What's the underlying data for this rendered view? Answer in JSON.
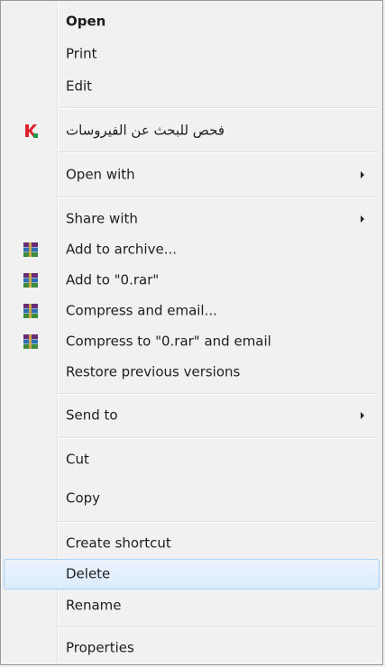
{
  "menu": {
    "items": [
      {
        "label": "Open"
      },
      {
        "label": "Print"
      },
      {
        "label": "Edit"
      },
      {
        "label": "فحص للبحث عن الفيروسات",
        "icon": "kaspersky-k-icon"
      },
      {
        "label": "Open with"
      },
      {
        "label": "Share with"
      },
      {
        "label": "Add to archive...",
        "icon": "winrar-books-icon"
      },
      {
        "label": "Add to \"0.rar\"",
        "icon": "winrar-books-icon"
      },
      {
        "label": "Compress and email...",
        "icon": "winrar-books-icon"
      },
      {
        "label": "Compress to \"0.rar\" and email",
        "icon": "winrar-books-icon"
      },
      {
        "label": "Restore previous versions"
      },
      {
        "label": "Send to"
      },
      {
        "label": "Cut"
      },
      {
        "label": "Copy"
      },
      {
        "label": "Create shortcut"
      },
      {
        "label": "Delete"
      },
      {
        "label": "Rename"
      },
      {
        "label": "Properties"
      }
    ]
  },
  "colors": {
    "menu_bg": "#f1f1f1",
    "hover_border": "#a8d1f5",
    "kaspersky_red": "#e0212d",
    "winrar_purple": "#6a2c74"
  }
}
